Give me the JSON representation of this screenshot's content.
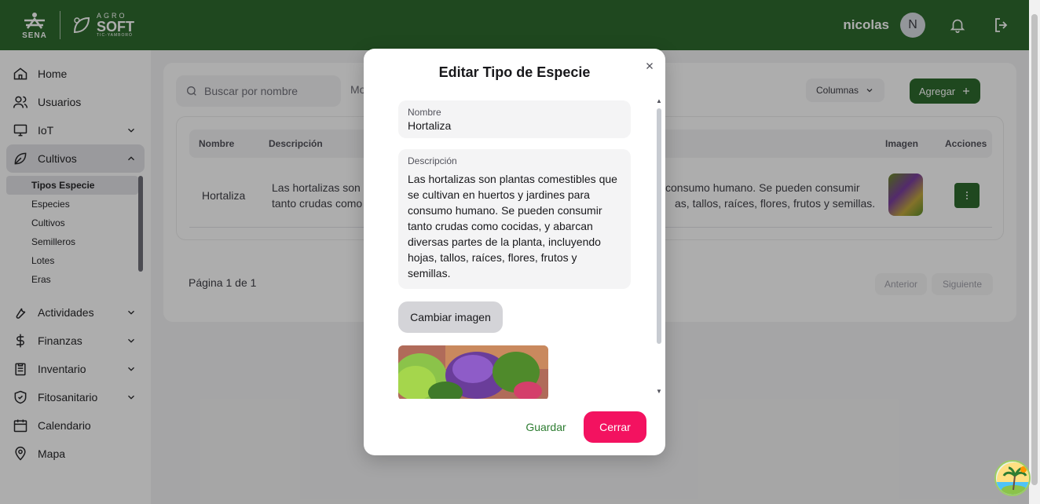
{
  "brand": {
    "sena": "SENA",
    "agro_top": "AGRO",
    "agro_main": "SOFT",
    "agro_sub": "TIC-YAMBORÓ"
  },
  "header": {
    "username": "nicolas",
    "avatar_initial": "N"
  },
  "sidebar": {
    "items": [
      {
        "label": "Home",
        "icon": "home-icon"
      },
      {
        "label": "Usuarios",
        "icon": "users-icon"
      },
      {
        "label": "IoT",
        "icon": "monitor-icon"
      },
      {
        "label": "Cultivos",
        "icon": "leaf-icon"
      },
      {
        "label": "Actividades",
        "icon": "wrench-icon"
      },
      {
        "label": "Finanzas",
        "icon": "dollar-icon"
      },
      {
        "label": "Inventario",
        "icon": "clipboard-icon"
      },
      {
        "label": "Fitosanitario",
        "icon": "shield-icon"
      },
      {
        "label": "Calendario",
        "icon": "calendar-icon"
      },
      {
        "label": "Mapa",
        "icon": "map-pin-icon"
      }
    ],
    "cultivos_sub": [
      "Tipos Especie",
      "Especies",
      "Cultivos",
      "Semilleros",
      "Lotes",
      "Eras"
    ]
  },
  "toolbar": {
    "search_placeholder": "Buscar por nombre",
    "filter_partial": "Mo",
    "columns_label": "Columnas",
    "add_label": "Agregar"
  },
  "table": {
    "headers": [
      "Nombre",
      "Descripción",
      "Imagen",
      "Acciones"
    ],
    "row": {
      "name": "Hortaliza",
      "desc_left_1": "Las hortalizas son p",
      "desc_left_2": "tanto crudas como",
      "desc_right_1": "consumo humano. Se pueden consumir",
      "desc_right_2": "as, tallos, raíces, flores, frutos y semillas."
    }
  },
  "pagination": {
    "label": "Página 1 de 1",
    "prev": "Anterior",
    "next": "Siguiente"
  },
  "modal": {
    "title": "Editar Tipo de Especie",
    "name_label": "Nombre",
    "name_value": "Hortaliza",
    "desc_label": "Descripción",
    "desc_value": "Las hortalizas son plantas comestibles que se cultivan en huertos y jardines para consumo humano. Se pueden consumir tanto crudas como cocidas, y abarcan diversas partes de la planta, incluyendo hojas, tallos, raíces, flores, frutos y semillas.",
    "change_image": "Cambiar imagen",
    "save": "Guardar",
    "close": "Cerrar"
  },
  "colors": {
    "primary": "#2e6b2f",
    "danger": "#f31260",
    "overlay": "rgba(0,0,0,0.32)"
  }
}
